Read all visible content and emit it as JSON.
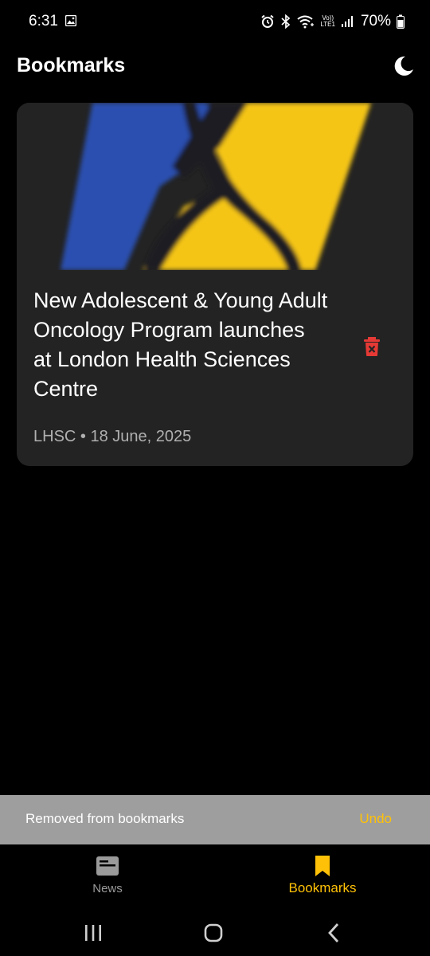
{
  "status_bar": {
    "time": "6:31",
    "battery": "70%",
    "lte_label_top": "Vo))",
    "lte_label_bottom": "LTE1"
  },
  "header": {
    "title": "Bookmarks"
  },
  "bookmarks": [
    {
      "title": "New Adolescent & Young Adult Oncology Program launches at London Health Sciences Centre",
      "source": "LHSC",
      "separator": "•",
      "date": "18 June, 2025"
    }
  ],
  "snackbar": {
    "message": "Removed from bookmarks",
    "action": "Undo"
  },
  "bottom_nav": {
    "items": [
      {
        "label": "News",
        "icon": "newspaper-icon",
        "active": false
      },
      {
        "label": "Bookmarks",
        "icon": "bookmark-icon",
        "active": true
      }
    ]
  },
  "colors": {
    "background": "#000000",
    "card": "#232323",
    "accent": "#ffc107",
    "delete": "#e53935",
    "snackbar": "#9e9e9e",
    "image_blue": "#2a4fb0",
    "image_yellow": "#f5c518"
  }
}
